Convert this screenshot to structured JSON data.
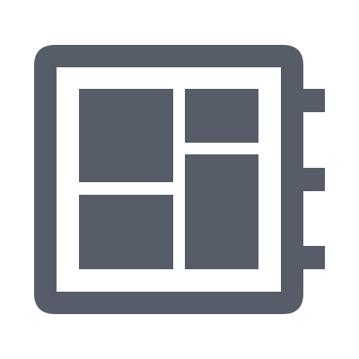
{
  "icon": {
    "name": "dashboard-notebook-icon",
    "color": "#565d69",
    "background": "#ffffff"
  }
}
